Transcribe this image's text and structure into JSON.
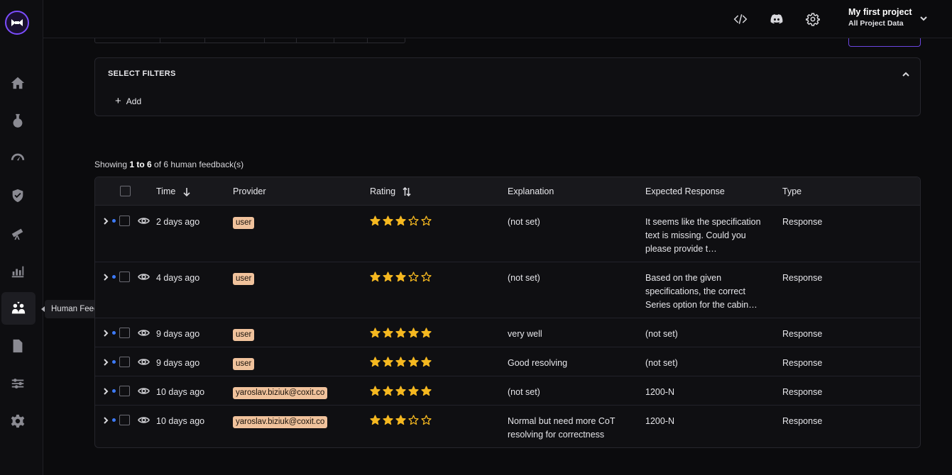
{
  "sidebar": {
    "tooltip": "Human Feedback",
    "items": [
      "home",
      "experiments",
      "dashboard",
      "guardrails",
      "deployments",
      "analytics",
      "human-feedback",
      "documents",
      "configurations",
      "settings"
    ]
  },
  "header": {
    "project_name": "My first project",
    "project_scope": "All Project Data"
  },
  "filters": {
    "title": "SELECT FILTERS",
    "add_label": "Add"
  },
  "summary": {
    "prefix": "Showing ",
    "range": "1 to 6",
    "suffix": " of 6 human feedback(s)"
  },
  "table": {
    "columns": {
      "time": "Time",
      "provider": "Provider",
      "rating": "Rating",
      "explanation": "Explanation",
      "expected": "Expected Response",
      "type": "Type"
    },
    "rows": [
      {
        "time": "2 days ago",
        "provider": "user",
        "rating": 3,
        "explanation": "(not set)",
        "expected": "It seems like the specification text is missing. Could you please provide t…",
        "type": "Response"
      },
      {
        "time": "4 days ago",
        "provider": "user",
        "rating": 3,
        "explanation": "(not set)",
        "expected": "Based on the given specifications, the correct Series option for the cabin…",
        "type": "Response"
      },
      {
        "time": "9 days ago",
        "provider": "user",
        "rating": 5,
        "explanation": "very well",
        "expected": "(not set)",
        "type": "Response"
      },
      {
        "time": "9 days ago",
        "provider": "user",
        "rating": 5,
        "explanation": "Good resolving",
        "expected": "(not set)",
        "type": "Response"
      },
      {
        "time": "10 days ago",
        "provider": "yaroslav.biziuk@coxit.co",
        "rating": 5,
        "explanation": "(not set)",
        "expected": "1200-N",
        "type": "Response"
      },
      {
        "time": "10 days ago",
        "provider": "yaroslav.biziuk@coxit.co",
        "rating": 3,
        "explanation": "Normal but need more CoT resolving for correctness",
        "expected": "1200-N",
        "type": "Response"
      }
    ]
  },
  "colors": {
    "accent": "#7c4dff",
    "star": "#f5b820",
    "badge": "#f0c29c",
    "dot": "#3d7bff"
  }
}
